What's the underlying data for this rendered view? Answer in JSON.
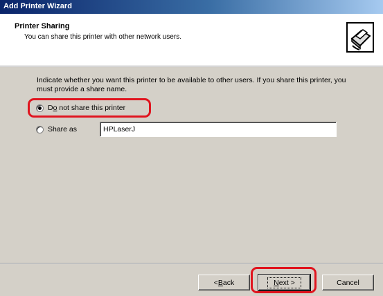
{
  "window": {
    "title": "Add Printer Wizard"
  },
  "header": {
    "title": "Printer Sharing",
    "subtitle": "You can share this printer with other network users.",
    "icon": "printer-share-icon"
  },
  "instructions": "Indicate whether you want this printer to be available to other users. If you share this printer, you must provide a share name.",
  "options": {
    "do_not_share": {
      "label_pre": "",
      "label_accel": "o",
      "label_first": "D",
      "label_rest": " not share this printer",
      "selected": true
    },
    "share_as": {
      "label": "Share as",
      "selected": false,
      "value": "HPLaserJ"
    }
  },
  "buttons": {
    "back_accel": "B",
    "back_rest": "ack",
    "back_prefix": "< ",
    "next_accel": "N",
    "next_rest": "ext",
    "next_suffix": " >",
    "cancel": "Cancel"
  },
  "colors": {
    "highlight": "#e0141e",
    "titlebar": "#0a246a"
  }
}
